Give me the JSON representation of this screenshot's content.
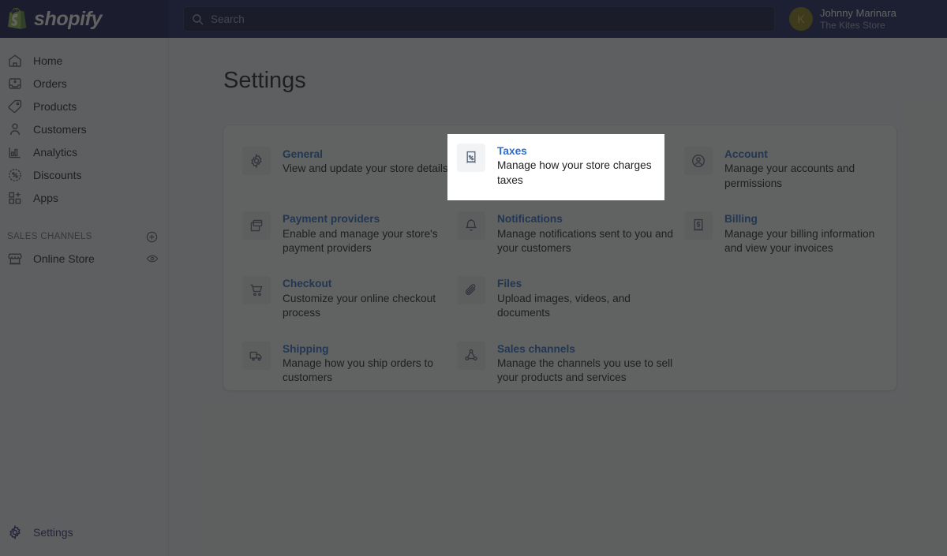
{
  "topbar": {
    "logo_text": "shopify",
    "logo_icon": "shopify-bag-icon",
    "search": {
      "icon": "search-icon",
      "placeholder": "Search",
      "value": ""
    },
    "user": {
      "avatar_initial": "K",
      "avatar_color": "#8a7a14",
      "name": "Johnny Marinara",
      "store": "The Kites Store"
    }
  },
  "sidebar": {
    "items": [
      {
        "label": "Home",
        "icon": "home-icon"
      },
      {
        "label": "Orders",
        "icon": "orders-inbox-icon"
      },
      {
        "label": "Products",
        "icon": "product-tag-icon"
      },
      {
        "label": "Customers",
        "icon": "customer-person-icon"
      },
      {
        "label": "Analytics",
        "icon": "analytics-bar-chart-icon"
      },
      {
        "label": "Discounts",
        "icon": "discount-percent-icon"
      },
      {
        "label": "Apps",
        "icon": "apps-grid-plus-icon"
      }
    ],
    "sales_channels": {
      "heading": "SALES CHANNELS",
      "add_icon": "plus-circle-icon",
      "channels": [
        {
          "label": "Online Store",
          "icon": "storefront-icon",
          "action_icon": "eye-preview-icon"
        }
      ]
    },
    "footer": {
      "label": "Settings",
      "icon": "gear-icon",
      "active_color": "#2c2f78"
    }
  },
  "main": {
    "page_title": "Settings",
    "settings": [
      {
        "title": "General",
        "desc": "View and update your store details",
        "icon": "gear-icon",
        "column": 1
      },
      {
        "title": "Taxes",
        "desc": "Manage how your store charges taxes",
        "icon": "tax-receipt-percent-icon",
        "column": 2,
        "highlighted": true
      },
      {
        "title": "Account",
        "desc": "Manage your accounts and permissions",
        "icon": "account-circle-person-icon",
        "column": 3
      },
      {
        "title": "Payment providers",
        "desc": "Enable and manage your store's payment providers",
        "icon": "payment-cards-icon",
        "column": 1
      },
      {
        "title": "Notifications",
        "desc": "Manage notifications sent to you and your customers",
        "icon": "bell-icon",
        "column": 2
      },
      {
        "title": "Billing",
        "desc": "Manage your billing information and view your invoices",
        "icon": "billing-receipt-dollar-icon",
        "column": 3
      },
      {
        "title": "Checkout",
        "desc": "Customize your online checkout process",
        "icon": "shopping-cart-icon",
        "column": 1
      },
      {
        "title": "Files",
        "desc": "Upload images, videos, and documents",
        "icon": "paperclip-icon",
        "column": 2
      },
      {
        "title": "Shipping",
        "desc": "Manage how you ship orders to customers",
        "icon": "delivery-truck-icon",
        "column": 1
      },
      {
        "title": "Sales channels",
        "desc": "Manage the channels you use to sell your products and services",
        "icon": "network-nodes-icon",
        "column": 2
      }
    ]
  },
  "overlay": {
    "dim_color": "#1e2020",
    "dim_opacity": 0.7,
    "spotlight_target": "Taxes"
  },
  "colors": {
    "brand_navy": "#1c2260",
    "link_blue": "#2c6ecb",
    "page_bg": "#f4f6f8",
    "text": "#202223",
    "muted_text": "#6d7175"
  }
}
